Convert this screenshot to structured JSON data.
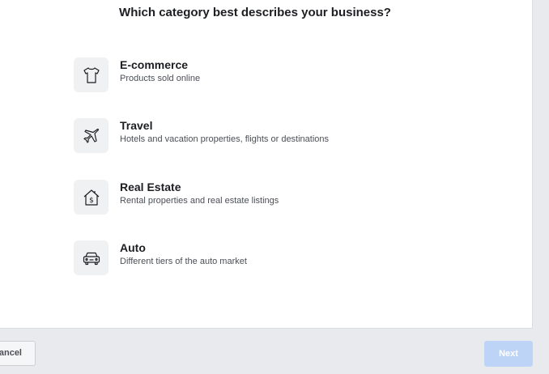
{
  "question": "Which category best describes your business?",
  "options": [
    {
      "title": "E-commerce",
      "description": "Products sold online",
      "icon": "tshirt-icon"
    },
    {
      "title": "Travel",
      "description": "Hotels and vacation properties, flights or destinations",
      "icon": "airplane-icon"
    },
    {
      "title": "Real Estate",
      "description": "Rental properties and real estate listings",
      "icon": "house-dollar-icon"
    },
    {
      "title": "Auto",
      "description": "Different tiers of the auto market",
      "icon": "car-icon"
    }
  ],
  "footer": {
    "cancel_label": "ancel",
    "next_label": "Next"
  },
  "colors": {
    "background": "#e9eaed",
    "card": "#ffffff",
    "icon_tile": "#f0f1f3",
    "next_disabled": "#bed4f6"
  }
}
